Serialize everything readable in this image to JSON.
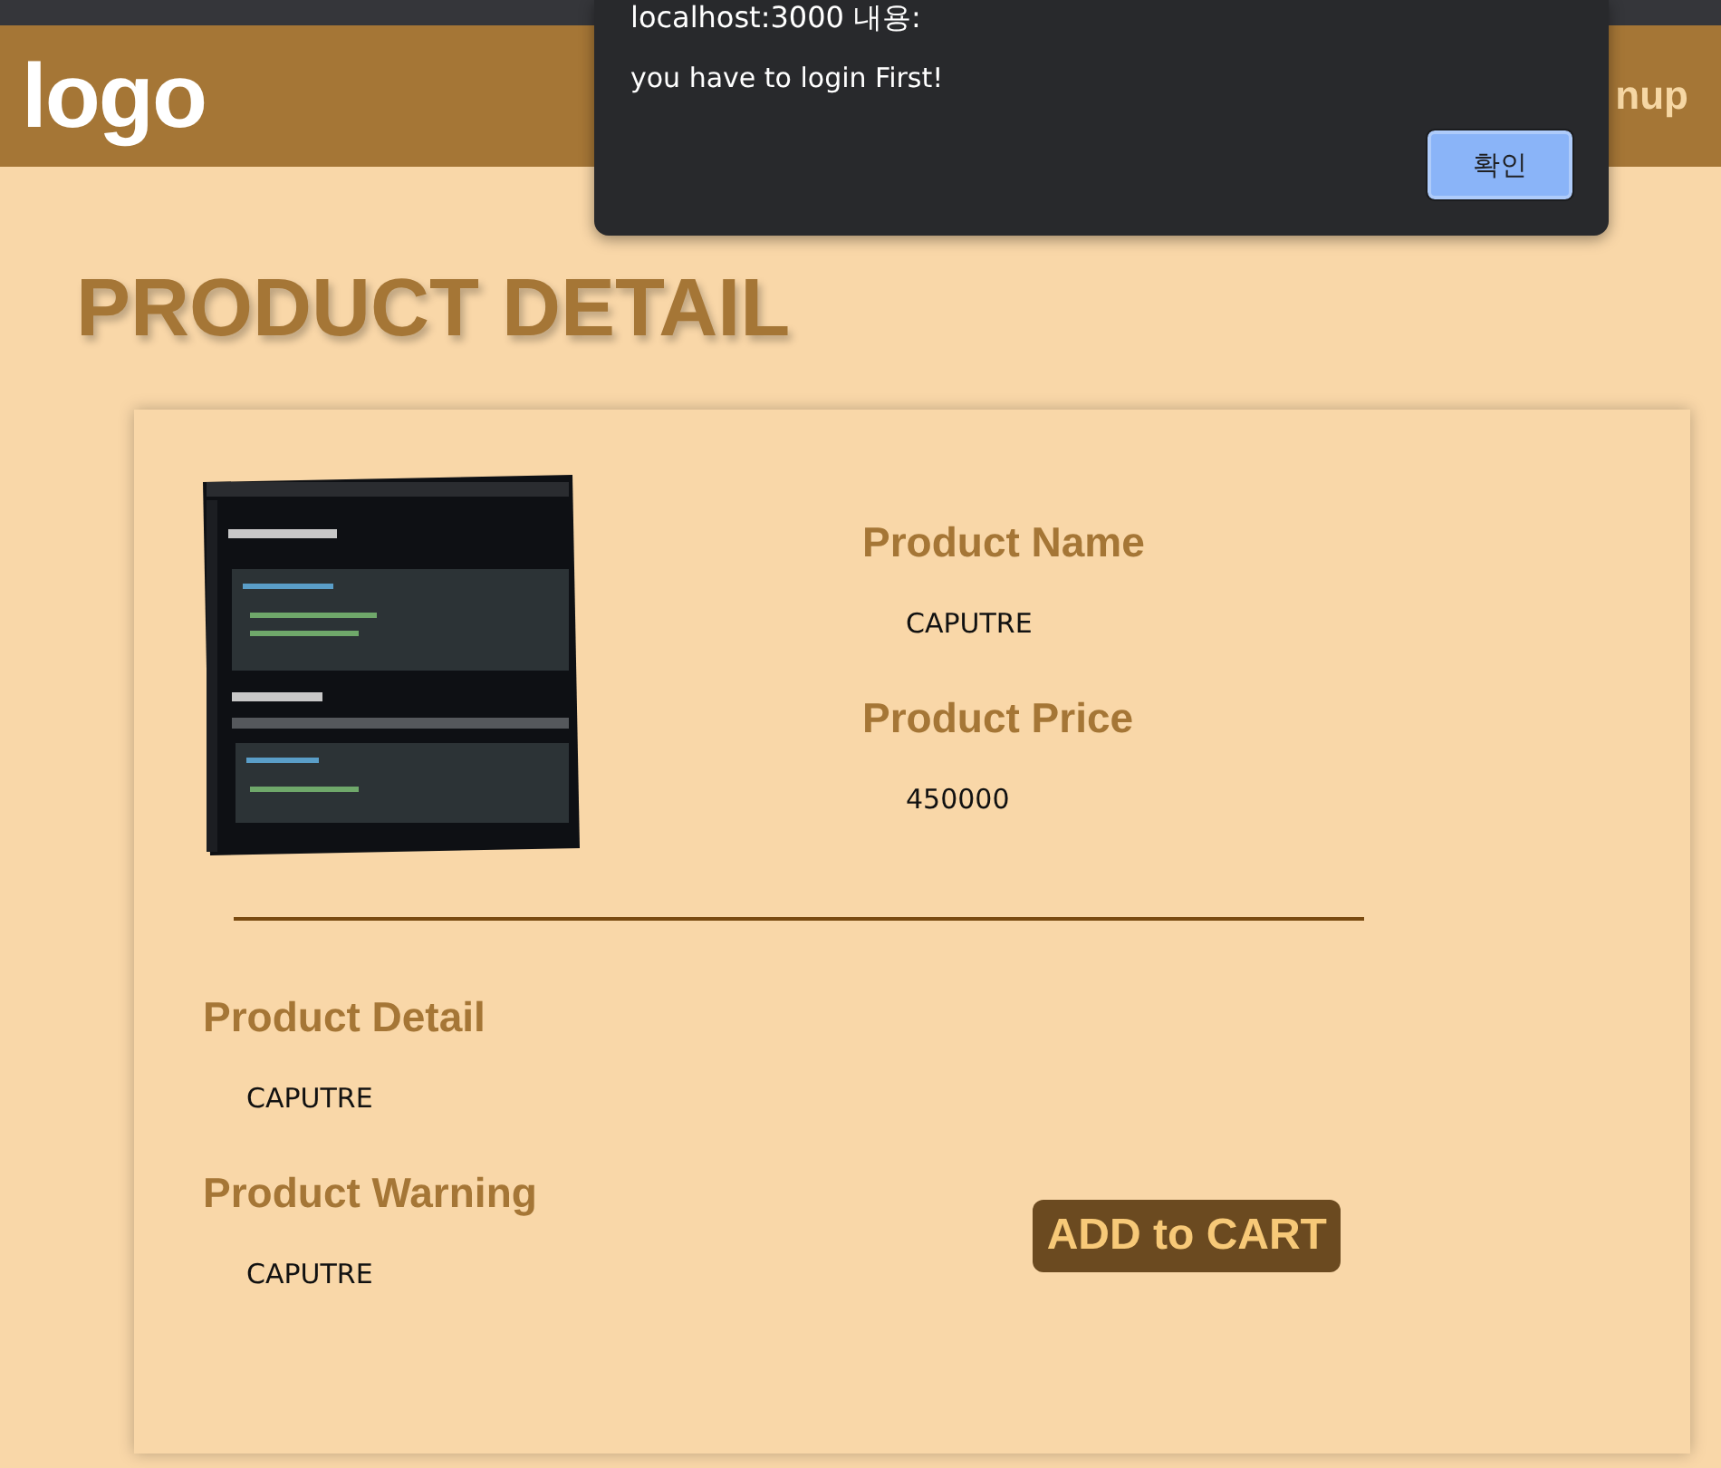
{
  "header": {
    "logo": "logo",
    "nav_link": "nup"
  },
  "dialog": {
    "title": "localhost:3000 내용:",
    "message": "you have to login First!",
    "button": "확인"
  },
  "page_title": "PRODUCT DETAIL",
  "product": {
    "fields": [
      {
        "label": "Product Name",
        "value": "CAPUTRE"
      },
      {
        "label": "Product Price",
        "value": "450000"
      }
    ],
    "sections": [
      {
        "label": "Product Detail",
        "value": "CAPUTRE"
      },
      {
        "label": "Product Warning",
        "value": "CAPUTRE"
      }
    ],
    "cart_button": "ADD to CART"
  }
}
